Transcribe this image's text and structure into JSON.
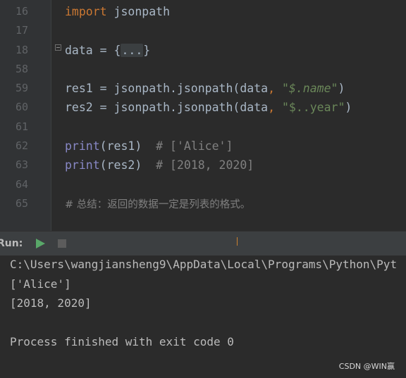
{
  "editor": {
    "line_numbers": [
      "16",
      "17",
      "18",
      "58",
      "59",
      "60",
      "61",
      "62",
      "63",
      "64",
      "65"
    ],
    "lines": {
      "l16": {
        "kw": "import",
        "rest": " jsonpath"
      },
      "l18": {
        "var": "data = {",
        "fold": "...",
        "close": "}"
      },
      "l59": {
        "pre": "res1 = jsonpath.jsonpath(data",
        "comma": ",",
        "sp": " ",
        "str": "\"$.name\"",
        "close": ")"
      },
      "l60": {
        "pre": "res2 = jsonpath.jsonpath(data",
        "comma": ",",
        "sp": " ",
        "str": "\"$..year\"",
        "close": ")"
      },
      "l62": {
        "fn": "print",
        "args": "(res1)",
        "comment": "  # ['Alice']"
      },
      "l63": {
        "fn": "print",
        "args": "(res2)",
        "comment": "  # [2018, 2020]"
      },
      "l65": {
        "comment": "# 总结：返回的数据一定是列表的格式。"
      }
    }
  },
  "run_panel": {
    "label": "Run:",
    "play_icon": "play-icon",
    "stop_icon": "stop-icon",
    "output": [
      "C:\\Users\\wangjiansheng9\\AppData\\Local\\Programs\\Python\\Pyt",
      "['Alice']",
      "[2018, 2020]",
      "",
      "Process finished with exit code 0"
    ]
  },
  "watermark": "CSDN @WIN赢",
  "colors": {
    "keyword": "#cc7832",
    "string": "#6a8759",
    "builtin": "#8888c6",
    "comment": "#808080",
    "text": "#a9b7c6",
    "background": "#2b2b2b",
    "run_green": "#59a869"
  }
}
